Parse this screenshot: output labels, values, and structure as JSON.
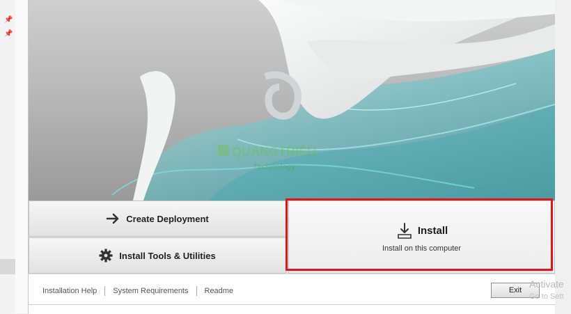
{
  "sidebar": {
    "pin_icon": "pin-icon"
  },
  "buttons": {
    "create_deployment": {
      "label": "Create Deployment",
      "icon": "arrow-right-icon"
    },
    "install_tools": {
      "label": "Install Tools & Utilities",
      "icon": "gear-icon"
    },
    "install": {
      "label": "Install",
      "sublabel": "Install on this computer",
      "icon": "download-icon"
    }
  },
  "highlight": {
    "color": "#e0161b"
  },
  "footer": {
    "links": [
      "Installation Help",
      "System Requirements",
      "Readme"
    ],
    "exit_label": "Exit"
  },
  "watermark": {
    "logo_text": "QUANGTRIỀU Technology",
    "activate": "Activate",
    "goto": "Go to Sett"
  }
}
